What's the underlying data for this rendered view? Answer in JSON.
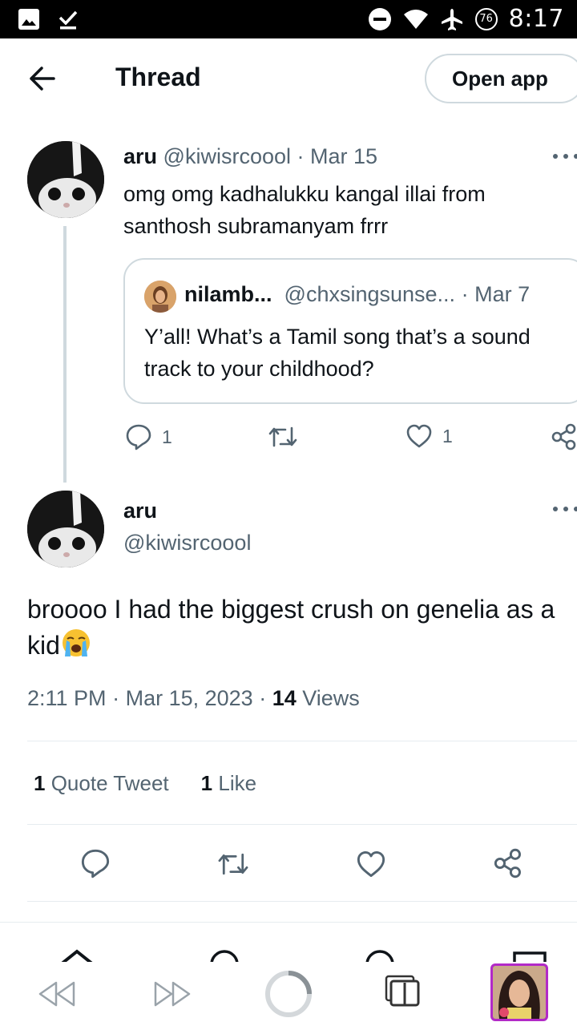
{
  "status_bar": {
    "time": "8:17",
    "battery": "76"
  },
  "header": {
    "title": "Thread",
    "open_app": "Open app"
  },
  "tweet1": {
    "name": "aru",
    "handle": "@kiwisrcoool",
    "date": "Mar 15",
    "text": "omg omg kadhalukku kangal illai from santhosh subramanyam frrr",
    "quote": {
      "name": "nilamb...",
      "handle": "@chxsingsunse...",
      "date": "Mar 7",
      "text": "Y’all! What’s a Tamil song that’s a sound track to your childhood?"
    },
    "replies": "1",
    "likes": "1"
  },
  "tweet2": {
    "name": "aru",
    "handle": "@kiwisrcoool",
    "text": "broooo I had the biggest crush on genelia as a kid",
    "time": "2:11 PM",
    "date": "Mar 15, 2023",
    "views_count": "14",
    "views_label": "Views",
    "quote_count": "1",
    "quote_label": "Quote Tweet",
    "like_count": "1",
    "like_label": "Like"
  },
  "colors": {
    "muted": "#536471",
    "border": "#cfd9de",
    "accent": "#b22ac7"
  }
}
